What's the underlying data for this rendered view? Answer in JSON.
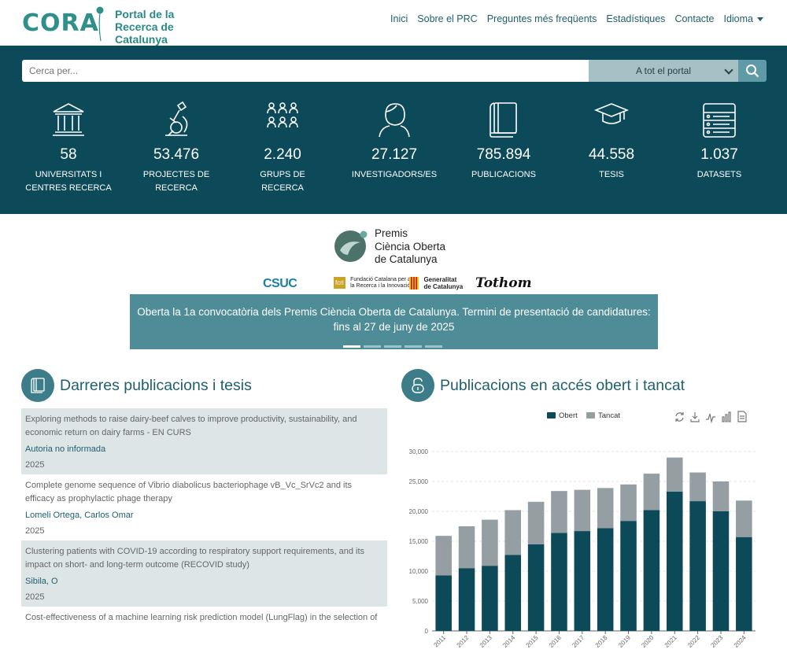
{
  "header": {
    "logo_name": "CORA",
    "logo_sub_line1": "Portal de la",
    "logo_sub_line2": "Recerca de Catalunya",
    "nav": [
      "Inici",
      "Sobre el PRC",
      "Preguntes més freqüents",
      "Estadístiques",
      "Contacte",
      "Idioma"
    ]
  },
  "search": {
    "placeholder": "Cerca per...",
    "scope": "A tot el portal",
    "icon": "search-icon"
  },
  "stats": [
    {
      "value": "58",
      "label1": "UNIVERSITATS I",
      "label2": "CENTRES RECERCA",
      "icon": "institution-icon"
    },
    {
      "value": "53.476",
      "label1": "PROJECTES DE",
      "label2": "RECERCA",
      "icon": "microscope-icon"
    },
    {
      "value": "2.240",
      "label1": "GRUPS DE",
      "label2": "RECERCA",
      "icon": "group-icon"
    },
    {
      "value": "27.127",
      "label1": "INVESTIGADORS/ES",
      "label2": "",
      "icon": "researcher-icon"
    },
    {
      "value": "785.894",
      "label1": "PUBLICACIONS",
      "label2": "",
      "icon": "book-icon"
    },
    {
      "value": "44.558",
      "label1": "TESIS",
      "label2": "",
      "icon": "graduation-cap-icon"
    },
    {
      "value": "1.037",
      "label1": "DATASETS",
      "label2": "",
      "icon": "database-icon"
    }
  ],
  "premis": {
    "line1": "Premis",
    "line2": "Ciència Oberta",
    "line3": "de Catalunya",
    "sponsors": {
      "csuc": "CSUC",
      "fcri_short": "fcri",
      "fcri_line1": "Fundació Catalana per a",
      "fcri_line2": "la Recerca i la Innovació",
      "gencat_line1": "Generalitat",
      "gencat_line2": "de Catalunya",
      "tothom": "Tothom"
    }
  },
  "banner": {
    "line1": "Oberta la 1a convocatòria dels Premis Ciència Oberta de Catalunya. Termini de presentació de candidatures:",
    "line2": "fins al 27 de juny de 2025",
    "active_slide": 1,
    "slides": 5
  },
  "publications": {
    "title": "Darreres publicacions i tesis",
    "items": [
      {
        "title": "Exploring methods to raise dairy-beef calves to improve productivity, sustainability, and economic return on dairy farms - EN CURS",
        "author": "Autoria no informada",
        "year": "2025"
      },
      {
        "title": "Complete genome sequence of Vibrio diabolicus bacteriophage vB_Vc_SrVc2 and its efficacy as prophylactic phage therapy",
        "author": "Lomeli Ortega, Carlos Omar",
        "year": "2025"
      },
      {
        "title": "Clustering patients with COVID-19 according to respiratory support requirements, and its impact on short- and long-term outcome (RECOVID study)",
        "author": "Sibila, O",
        "year": "2025"
      },
      {
        "title": "Cost-effectiveness of a machine learning risk prediction model (LungFlag) in the selection of",
        "author": "",
        "year": ""
      }
    ]
  },
  "chart_data": {
    "type": "bar",
    "title": "Publicacions en accés obert i tancat",
    "stacked": true,
    "categories": [
      "2011",
      "2012",
      "2013",
      "2014",
      "2015",
      "2016",
      "2017",
      "2018",
      "2019",
      "2020",
      "2021",
      "2022",
      "2023",
      "2024"
    ],
    "series": [
      {
        "name": "Obert",
        "color": "#0c4a5a",
        "values": [
          9300,
          10500,
          10900,
          12700,
          14500,
          16400,
          16700,
          17200,
          18400,
          20200,
          23300,
          21700,
          20000,
          15700
        ]
      },
      {
        "name": "Tancat",
        "color": "#959ea3",
        "values": [
          6600,
          7000,
          7700,
          7500,
          7100,
          7000,
          6900,
          6700,
          6100,
          6100,
          5700,
          4800,
          5000,
          6100
        ]
      }
    ],
    "ylim": [
      0,
      30000
    ],
    "yticks": [
      "0",
      "5,000",
      "10,000",
      "15,000",
      "20,000",
      "25,000",
      "30,000"
    ],
    "grid": true,
    "legend": "top-center"
  }
}
